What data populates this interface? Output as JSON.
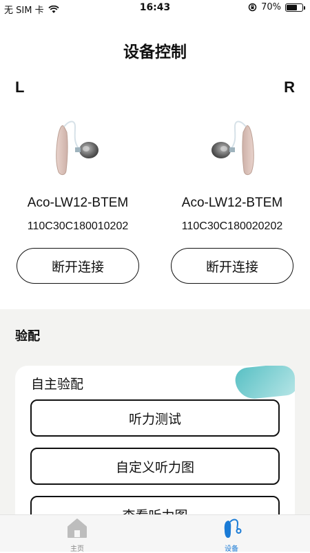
{
  "status_bar": {
    "carrier": "无 SIM 卡",
    "time": "16:43",
    "battery_text": "70%",
    "battery_level": 0.7
  },
  "page": {
    "title": "设备控制"
  },
  "left_device": {
    "side": "L",
    "model": "Aco-LW12-BTEM",
    "serial": "110C30C180010202",
    "disconnect_label": "断开连接"
  },
  "right_device": {
    "side": "R",
    "model": "Aco-LW12-BTEM",
    "serial": "110C30C180020202",
    "disconnect_label": "断开连接"
  },
  "fitting": {
    "section_title": "验配",
    "card_title": "自主验配",
    "options": [
      "听力测试",
      "自定义听力图",
      "查看听力图"
    ]
  },
  "tab_bar": {
    "tabs": [
      {
        "label": "主页",
        "active": false
      },
      {
        "label": "设备",
        "active": true
      }
    ]
  },
  "colors": {
    "accent": "#1a7bd6",
    "section_bg": "#f3f3f1",
    "blob": "#58c0c4"
  }
}
